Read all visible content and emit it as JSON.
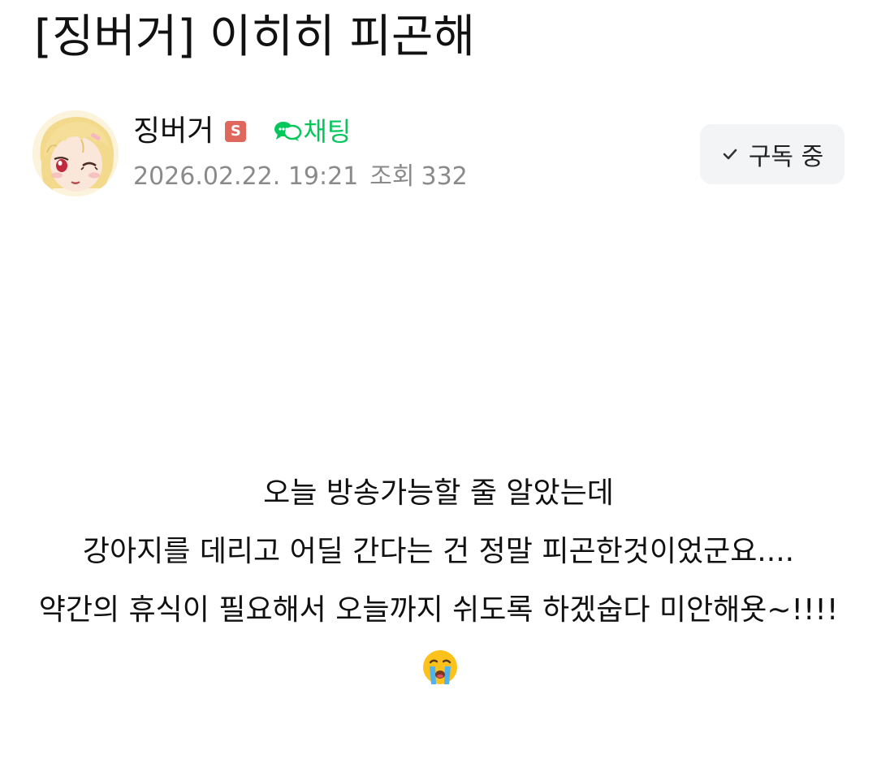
{
  "post": {
    "title": "[징버거] 이히히 피곤해"
  },
  "author": {
    "name": "징버거",
    "badge": "S",
    "badge_color": "#e0675c",
    "avatar_icon": "anime-girl-avatar"
  },
  "chat": {
    "label": "채팅",
    "icon": "chat-bubbles-icon",
    "color": "#03c75a"
  },
  "meta": {
    "date": "2026.02.22. 19:21",
    "views_label": "조회",
    "views_count": "332"
  },
  "subscribe": {
    "label": "구독 중",
    "icon": "check-icon"
  },
  "body": {
    "line1": "오늘 방송가능할 줄 알았는데",
    "line2": "강아지를 데리고 어딜 간다는 건 정말 피곤한것이었군요....",
    "line3": "약간의 휴식이 필요해서 오늘까지 쉬도록 하겠숩다 미안해욧~!!!!",
    "emoji": "loudly-crying-face"
  }
}
